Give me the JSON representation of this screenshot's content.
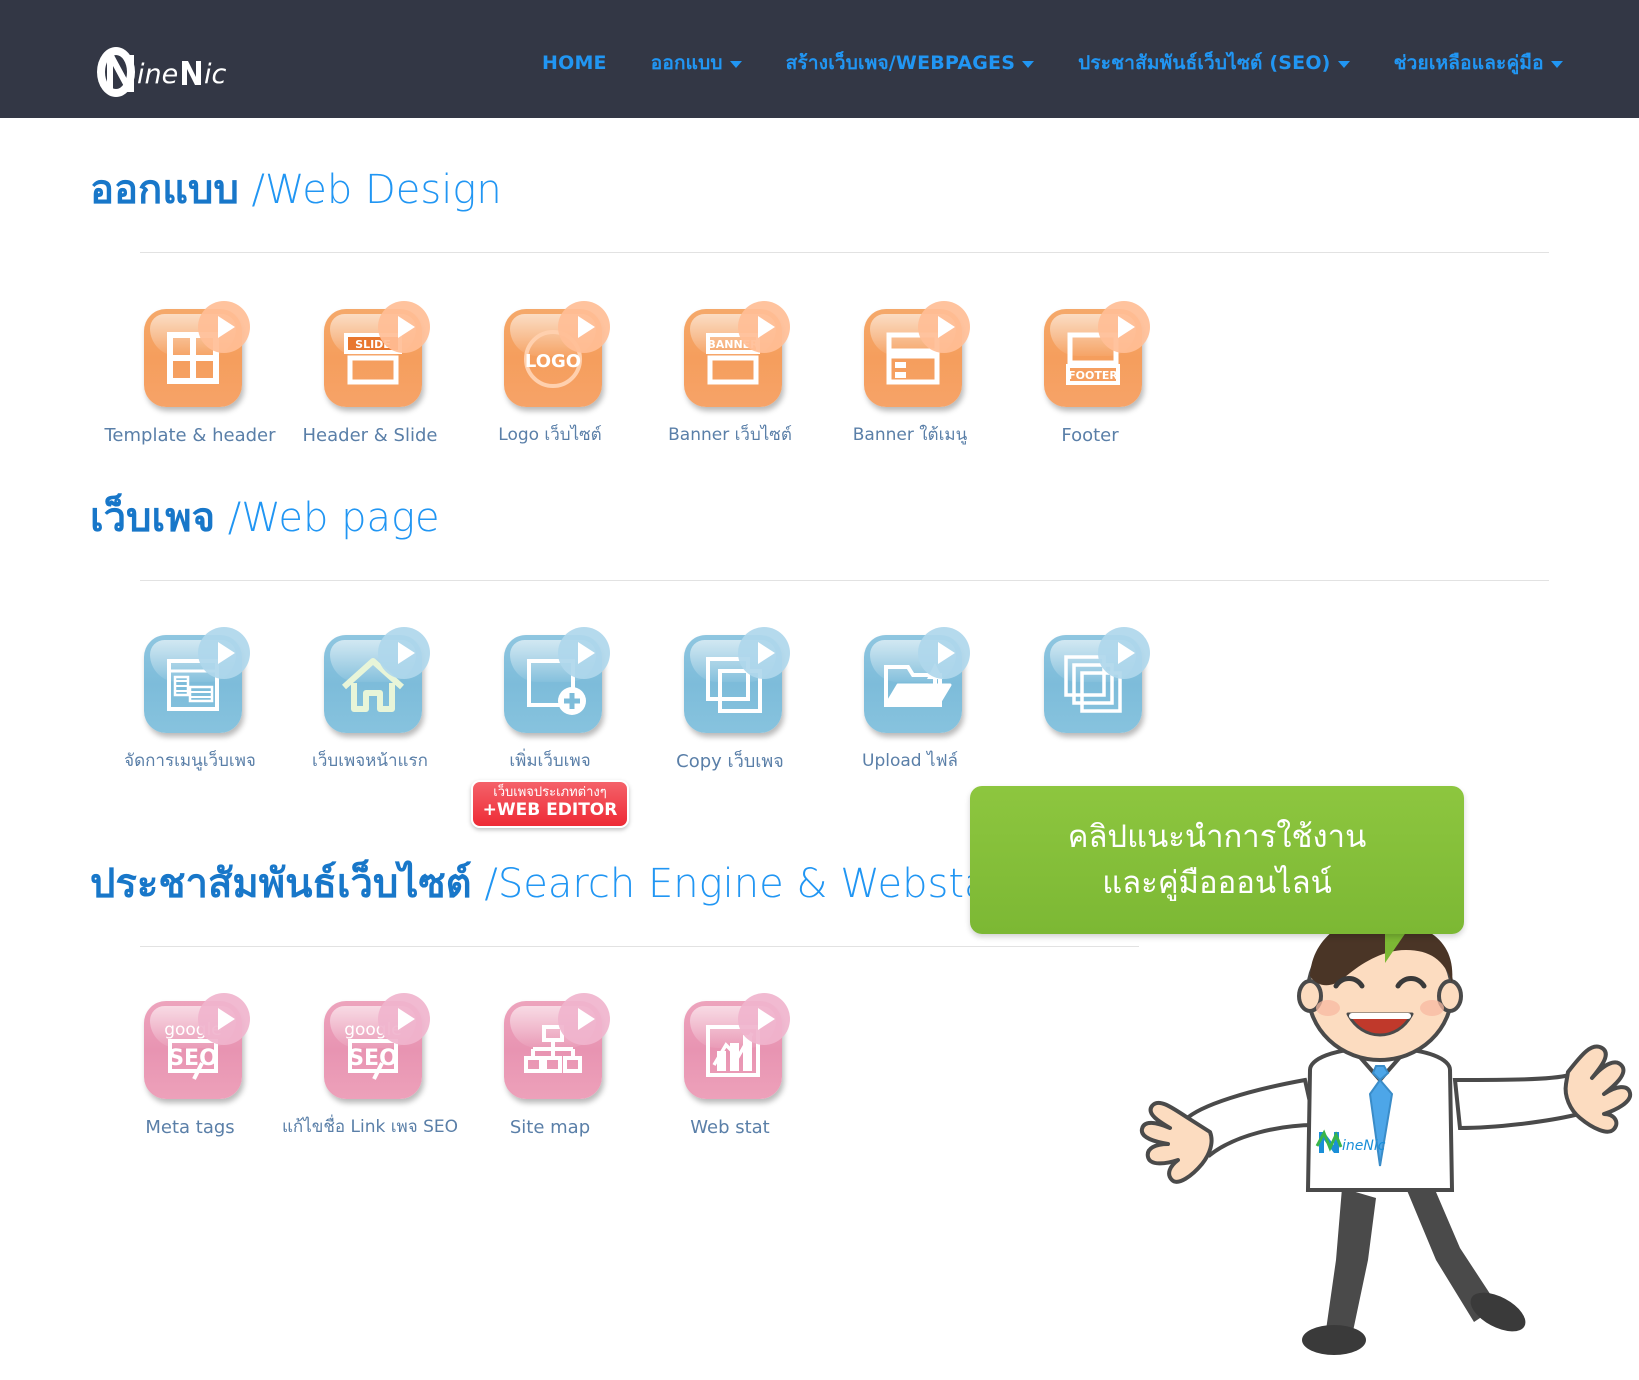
{
  "navbar": {
    "brand": "NineNic",
    "items": [
      {
        "label": "HOME",
        "has_caret": false
      },
      {
        "label": "ออกแบบ",
        "has_caret": true
      },
      {
        "label": "สร้างเว็บเพจ/WEBPAGES",
        "has_caret": true
      },
      {
        "label": "ประชาสัมพันธ์เว็บไซต์ (SEO)",
        "has_caret": true
      },
      {
        "label": "ช่วยเหลือและคู่มือ",
        "has_caret": true
      }
    ],
    "background_color": "#333745",
    "link_color": "#2196f3"
  },
  "sections": [
    {
      "title_th": "ออกแบบ",
      "title_en": "/Web Design",
      "color": "orange",
      "accent_color": "#f59e5d",
      "items": [
        {
          "label": "Template & header",
          "icon": "grid-four-panes-icon",
          "badge": null
        },
        {
          "label": "Header & Slide",
          "icon": "slide-header-icon",
          "badge": null
        },
        {
          "label": "Logo เว็บไซต์",
          "icon": "logo-circle-icon",
          "badge": null
        },
        {
          "label": "Banner เว็บไซต์",
          "icon": "banner-top-icon",
          "badge": null
        },
        {
          "label": "Banner ใต้เมนู",
          "icon": "banner-under-menu-icon",
          "badge": null
        },
        {
          "label": "Footer",
          "icon": "footer-icon",
          "badge": null
        }
      ]
    },
    {
      "title_th": "เว็บเพจ",
      "title_en": "/Web page",
      "color": "blue",
      "accent_color": "#7dbcda",
      "items": [
        {
          "label": "จัดการเมนูเว็บเพจ",
          "icon": "manage-webpage-menu-icon",
          "badge": null
        },
        {
          "label": "เว็บเพจหน้าแรก",
          "icon": "home-house-icon",
          "badge": null
        },
        {
          "label": "เพิ่มเว็บเพจ",
          "icon": "add-page-plus-icon",
          "badge": {
            "line1": "เว็บเพจประเภทต่างๆ",
            "line2": "+WEB EDITOR",
            "color": "#ee2a35"
          }
        },
        {
          "label": "Copy เว็บเพจ",
          "icon": "copy-pages-icon",
          "badge": null
        },
        {
          "label": "Upload ไฟล์",
          "icon": "upload-folder-icon",
          "badge": null
        },
        {
          "label": "",
          "icon": "stacked-pages-icon",
          "badge": null
        }
      ]
    },
    {
      "title_th": "ประชาสัมพันธ์เว็บไซต์",
      "title_en": "/Search Engine & Webstat",
      "color": "pink",
      "accent_color": "#e894b2",
      "items": [
        {
          "label": "Meta tags",
          "icon": "google-seo-icon",
          "badge": null
        },
        {
          "label": "แก้ไขชื่อ Link เพจ SEO",
          "icon": "google-seo-icon",
          "badge": null
        },
        {
          "label": "Site map",
          "icon": "sitemap-icon",
          "badge": null
        },
        {
          "label": "Web stat",
          "icon": "web-stat-chart-icon",
          "badge": null
        }
      ]
    }
  ],
  "callout": {
    "line1": "คลิปแนะนำการใช้งาน",
    "line2": "และคู่มือออนไลน์",
    "background_color": "#8cc63f",
    "text_color": "#ffffff"
  },
  "mascot": {
    "shirt_logo": "NineNic",
    "description": "cartoon-businessman-waving"
  }
}
